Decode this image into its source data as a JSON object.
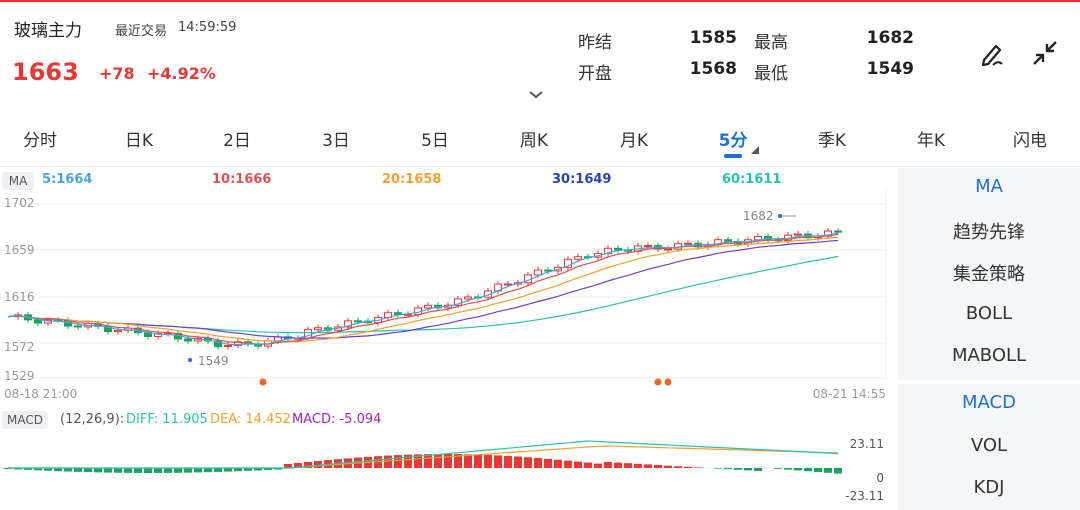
{
  "header": {
    "name": "玻璃主力",
    "recent_label": "最近交易",
    "recent_time": "14:59:59",
    "price": "1663",
    "change": "+78",
    "change_pct": "+4.92%",
    "stats": {
      "prev_settle_label": "昨结",
      "prev_settle": "1585",
      "open_label": "开盘",
      "open": "1568",
      "high_label": "最高",
      "high": "1682",
      "low_label": "最低",
      "low": "1549"
    }
  },
  "tabs": [
    "分时",
    "日K",
    "2日",
    "3日",
    "5日",
    "周K",
    "月K",
    "5分",
    "季K",
    "年K",
    "闪电"
  ],
  "active_tab": "5分",
  "ma_legend": {
    "tag": "MA",
    "ma5": "5:1664",
    "ma10": "10:1666",
    "ma20": "20:1658",
    "ma30": "30:1649",
    "ma60": "60:1611"
  },
  "colors": {
    "up": "#e53935",
    "down": "#1aa35a",
    "accent": "#1f6fd6",
    "ma5": "#4aa3df",
    "ma10": "#d9534f",
    "ma20": "#f0a030",
    "ma30": "#6a3fc9",
    "ma60": "#2bbfb0"
  },
  "main_chart": {
    "y_ticks": [
      "1702",
      "1659",
      "1616",
      "1572",
      "1529"
    ],
    "start_time": "08-18 21:00",
    "end_time": "08-21 14:55",
    "high_marker": "1682",
    "low_marker": "1549"
  },
  "macd": {
    "tag": "MACD",
    "params": "(12,26,9):",
    "diff": "DIFF: 11.905",
    "dea": "DEA: 14.452",
    "macd": "MACD: -5.094",
    "y_top": "23.11",
    "y_mid": "0",
    "y_bottom": "-23.11"
  },
  "side_top": [
    "MA",
    "趋势先锋",
    "集金策略",
    "BOLL",
    "MABOLL"
  ],
  "side_bottom": [
    "MACD",
    "VOL",
    "KDJ"
  ]
}
